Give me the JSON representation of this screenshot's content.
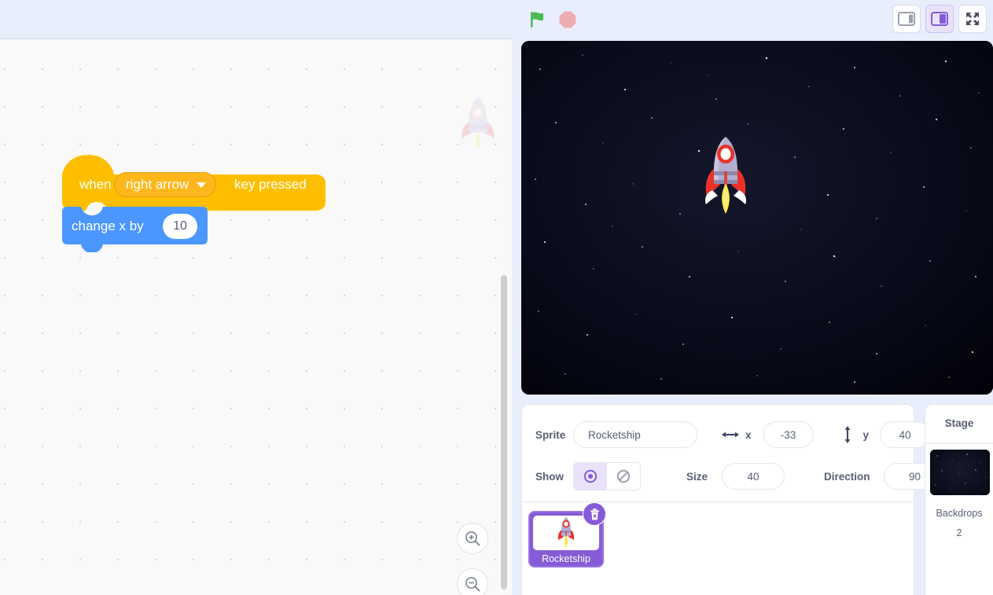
{
  "toolbar": {
    "green_flag_icon": "green-flag-icon",
    "stop_icon": "stop-sign-icon",
    "small_stage_icon": "small-stage-layout-icon",
    "normal_stage_icon": "normal-stage-layout-icon",
    "fullscreen_icon": "fullscreen-icon",
    "selected_layout": "normal"
  },
  "workspace": {
    "zoom_in_icon": "zoom-in-icon",
    "zoom_out_icon": "zoom-out-icon",
    "watermark_icon": "sprite-watermark-rocketship"
  },
  "script": {
    "hat_block": {
      "prefix": "when",
      "dropdown_value": "right arrow",
      "suffix": "key pressed",
      "color": "#ffbf00",
      "dropdown_color": "#ffb71c"
    },
    "motion_block": {
      "label": "change x by",
      "value": "10",
      "color": "#4c97ff"
    }
  },
  "stage": {
    "backdrop_name": "stars",
    "sprite_icon": "rocketship-sprite"
  },
  "sprite_info": {
    "sprite_label": "Sprite",
    "sprite_name": "Rocketship",
    "x_label": "x",
    "x_value": "-33",
    "y_label": "y",
    "y_value": "40",
    "show_label": "Show",
    "show_on_icon": "eye-icon",
    "show_off_icon": "eye-crossed-icon",
    "show_state": "visible",
    "size_label": "Size",
    "size_value": "40",
    "direction_label": "Direction",
    "direction_value": "90",
    "x_axis_icon": "horizontal-arrows-icon",
    "y_axis_icon": "vertical-arrows-icon"
  },
  "sprite_list": {
    "items": [
      {
        "name": "Rocketship",
        "thumb_icon": "rocketship-thumbnail",
        "delete_icon": "trash-icon",
        "selected": true
      }
    ]
  },
  "stage_panel": {
    "title": "Stage",
    "backdrops_label": "Backdrops",
    "backdrops_count": "2",
    "thumb_icon": "starry-backdrop-thumbnail"
  },
  "colors": {
    "accent_purple": "#855cd6",
    "motion_blue": "#4c97ff",
    "event_yellow": "#ffbf00",
    "text_gray": "#575e75",
    "page_blue": "#e8eefc"
  }
}
